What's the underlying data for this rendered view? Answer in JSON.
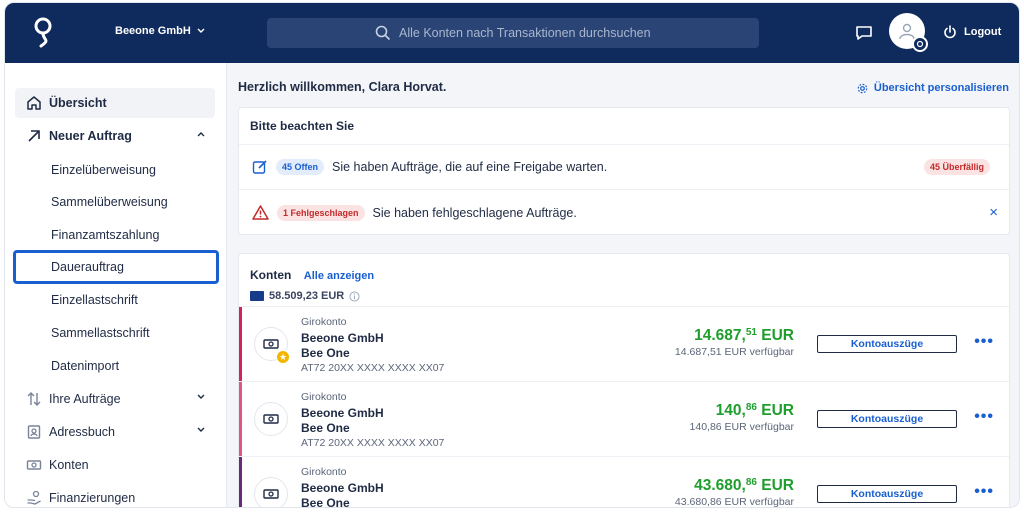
{
  "header": {
    "company": "Beeone GmbH",
    "search_placeholder": "Alle Konten nach Transaktionen durchsuchen",
    "logout": "Logout"
  },
  "sidebar": {
    "items": [
      {
        "label": "Übersicht"
      },
      {
        "label": "Neuer Auftrag"
      },
      {
        "label": "Einzelüberweisung"
      },
      {
        "label": "Sammelüberweisung"
      },
      {
        "label": "Finanzamtszahlung"
      },
      {
        "label": "Dauerauftrag"
      },
      {
        "label": "Einzellastschrift"
      },
      {
        "label": "Sammellastschrift"
      },
      {
        "label": "Datenimport"
      },
      {
        "label": "Ihre Aufträge"
      },
      {
        "label": "Adressbuch"
      },
      {
        "label": "Konten"
      },
      {
        "label": "Finanzierungen"
      }
    ]
  },
  "main": {
    "welcome": "Herzlich willkommen, Clara Horvat.",
    "personalize": "Übersicht personalisieren",
    "notice": {
      "title": "Bitte beachten Sie",
      "open_pill": "45 Offen",
      "open_text": "Sie haben Aufträge, die auf eine Freigabe warten.",
      "overdue_pill": "45 Überfällig",
      "failed_pill": "1 Fehlgeschlagen",
      "failed_text": "Sie haben fehlgeschlagene Aufträge.",
      "close": "×"
    },
    "accounts": {
      "title": "Konten",
      "show_all": "Alle anzeigen",
      "total": "58.509,23 EUR",
      "rows": [
        {
          "type": "Girokonto",
          "name": "Beeone GmbH",
          "sub": "Bee One",
          "iban": "AT72 20XX XXXX XXXX XX07",
          "amount_main": "14.687,",
          "amount_cents": "51",
          "currency": " EUR",
          "available": "14.687,51 EUR verfügbar",
          "button": "Kontoauszüge",
          "bar_color": "#d0245b"
        },
        {
          "type": "Girokonto",
          "name": "Beeone GmbH",
          "sub": "Bee One",
          "iban": "AT72 20XX XXXX XXXX XX07",
          "amount_main": "140,",
          "amount_cents": "86",
          "currency": " EUR",
          "available": "140,86 EUR verfügbar",
          "button": "Kontoauszüge",
          "bar_color": "#e05580"
        },
        {
          "type": "Girokonto",
          "name": "Beeone GmbH",
          "sub": "Bee One",
          "iban": "",
          "amount_main": "43.680,",
          "amount_cents": "86",
          "currency": " EUR",
          "available": "43.680,86 EUR verfügbar",
          "button": "Kontoauszüge",
          "bar_color": "#6a2a7a"
        }
      ]
    }
  },
  "colors": {
    "brand_navy": "#0f2a5c",
    "link_blue": "#1a5fd0",
    "amount_green": "#1e9e2c",
    "alert_red": "#c22a2a"
  }
}
